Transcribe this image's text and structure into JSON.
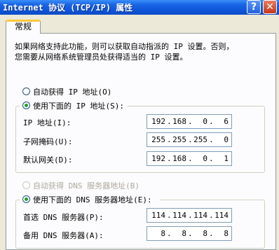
{
  "window": {
    "title": "Internet 协议 (TCP/IP) 属性",
    "help_label": "?",
    "close_label": "✕"
  },
  "tabs": [
    {
      "label": "常规"
    }
  ],
  "description": {
    "line1": "如果网络支持此功能，则可以获取自动指派的 IP 设置。否则，",
    "line2": "您需要从网络系统管理员处获得适当的 IP 设置。"
  },
  "ip_mode": {
    "auto_label": "自动获得 IP 地址(O)",
    "manual_label": "使用下面的 IP 地址(S):",
    "selected": "manual"
  },
  "ip_fields": [
    {
      "label": "IP 地址(I):",
      "octets": [
        "192",
        "168",
        "0",
        "6"
      ]
    },
    {
      "label": "子网掩码(U):",
      "octets": [
        "255",
        "255",
        "255",
        "0"
      ]
    },
    {
      "label": "默认网关(D):",
      "octets": [
        "192",
        "168",
        "0",
        "1"
      ]
    }
  ],
  "dns_mode": {
    "auto_label": "自动获得 DNS 服务器地址(B)",
    "auto_enabled": false,
    "manual_label": "使用下面的 DNS 服务器地址(E):",
    "selected": "manual"
  },
  "dns_fields": [
    {
      "label": "首选 DNS 服务器(P):",
      "octets": [
        "114",
        "114",
        "114",
        "114"
      ]
    },
    {
      "label": "备用 DNS 服务器(A):",
      "octets": [
        "8",
        "8",
        "8",
        "8"
      ]
    }
  ],
  "dot": "."
}
